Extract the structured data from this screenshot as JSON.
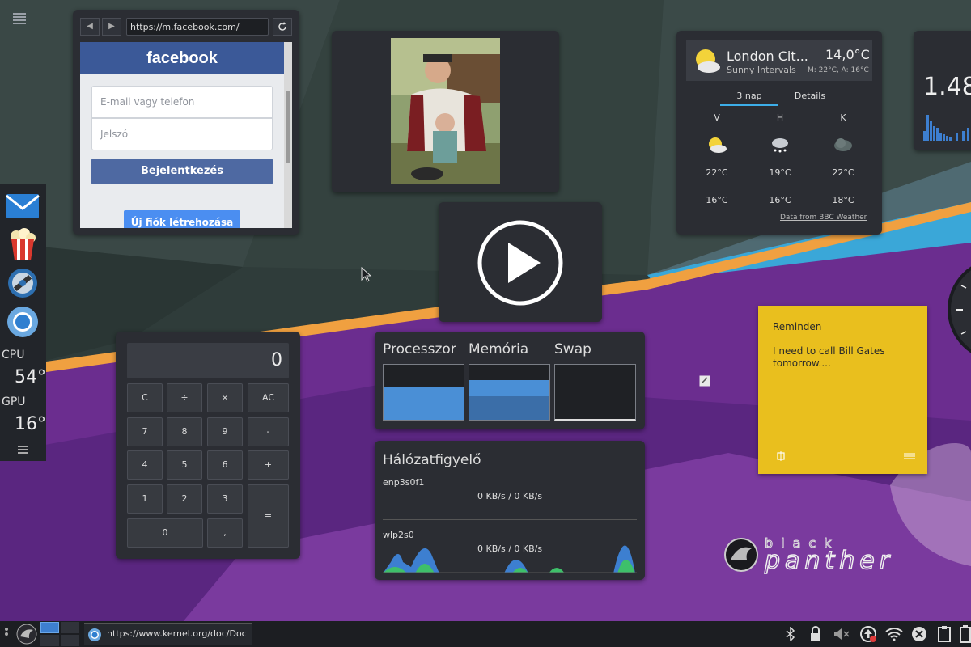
{
  "browser": {
    "url": "https://m.facebook.com/",
    "fb_logo": "facebook",
    "email_placeholder": "E-mail vagy telefon",
    "password_placeholder": "Jelszó",
    "login_label": "Bejelentkezés",
    "new_account_label": "Új fiók létrehozása"
  },
  "dock": {
    "cpu_label": "CPU",
    "cpu_value": "54°",
    "gpu_label": "GPU",
    "gpu_value": "16°",
    "apps": [
      "mail-icon",
      "popcorn-icon",
      "video-player-icon",
      "chromium-icon"
    ]
  },
  "calculator": {
    "display": "0",
    "keys": [
      [
        "C",
        "÷",
        "×",
        "AC"
      ],
      [
        "7",
        "8",
        "9",
        "-"
      ],
      [
        "4",
        "5",
        "6",
        "+"
      ],
      [
        "1",
        "2",
        "3",
        "="
      ],
      [
        "0",
        ","
      ]
    ]
  },
  "weather": {
    "city": "London Cit...",
    "temp": "14,0°C",
    "condition": "Sunny Intervals",
    "minmax": "M: 22°C, A: 16°C",
    "tab_forecast": "3 nap",
    "tab_details": "Details",
    "days": [
      {
        "day": "V",
        "high": "22°C",
        "low": "16°C",
        "icon": "partly-sunny-icon"
      },
      {
        "day": "H",
        "high": "19°C",
        "low": "16°C",
        "icon": "snow-cloud-icon"
      },
      {
        "day": "K",
        "high": "22°C",
        "low": "18°C",
        "icon": "cloud-icon"
      }
    ],
    "credit": "Data from BBC Weather"
  },
  "partial_widget": {
    "value": "1.48"
  },
  "sysmon": {
    "cpu_label": "Processzor",
    "mem_label": "Memória",
    "swap_label": "Swap",
    "cpu_level": 0.6,
    "mem_level": 0.72,
    "swap_level": 0.0
  },
  "network": {
    "title": "Hálózatfigyelő",
    "iface1": "enp3s0f1",
    "iface1_rate": "0 KB/s / 0 KB/s",
    "iface2": "wlp2s0",
    "iface2_rate": "0 KB/s / 0 KB/s"
  },
  "note": {
    "title": "Reminden",
    "text1": "I need to call Bill Gates",
    "text2": "tomorrow...."
  },
  "brand": {
    "line1": "black",
    "line2": "panther"
  },
  "taskbar": {
    "task_url": "https://www.kernel.org/doc/Doc",
    "tray": [
      "bluetooth-icon",
      "lock-icon",
      "mute-icon",
      "update-icon",
      "wifi-icon",
      "close-circle-icon",
      "clipboard-icon",
      "battery-icon"
    ]
  },
  "colors": {
    "accent": "#3daee9",
    "purple": "#6b2d8f",
    "orange": "#f0a040",
    "note_yellow": "#e9bf1e"
  }
}
